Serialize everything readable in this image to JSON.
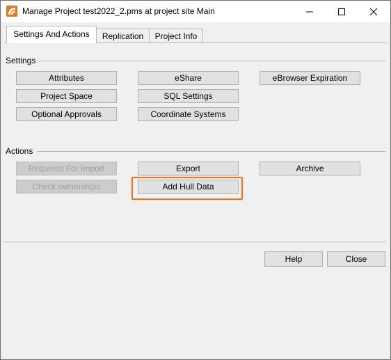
{
  "window": {
    "title": "Manage Project test2022_2.pms at project site Main"
  },
  "tabs": [
    {
      "label": "Settings And Actions",
      "active": true
    },
    {
      "label": "Replication",
      "active": false
    },
    {
      "label": "Project Info",
      "active": false
    }
  ],
  "settings": {
    "heading": "Settings",
    "buttons": [
      {
        "label": "Attributes"
      },
      {
        "label": "eShare"
      },
      {
        "label": "eBrowser Expiration"
      },
      {
        "label": "Project Space"
      },
      {
        "label": "SQL Settings"
      },
      {
        "label": "Optional Approvals"
      },
      {
        "label": "Coordinate Systems"
      }
    ]
  },
  "actions": {
    "heading": "Actions",
    "buttons": [
      {
        "label": "Requests For Import",
        "enabled": false
      },
      {
        "label": "Export",
        "enabled": true
      },
      {
        "label": "Archive",
        "enabled": true
      },
      {
        "label": "Check ownerships",
        "enabled": false
      },
      {
        "label": "Add Hull Data",
        "enabled": true,
        "highlighted": true
      }
    ]
  },
  "footer": {
    "help_label": "Help",
    "close_label": "Close"
  },
  "colors": {
    "highlight": "#e07b21",
    "app_icon": "#e8761e"
  }
}
